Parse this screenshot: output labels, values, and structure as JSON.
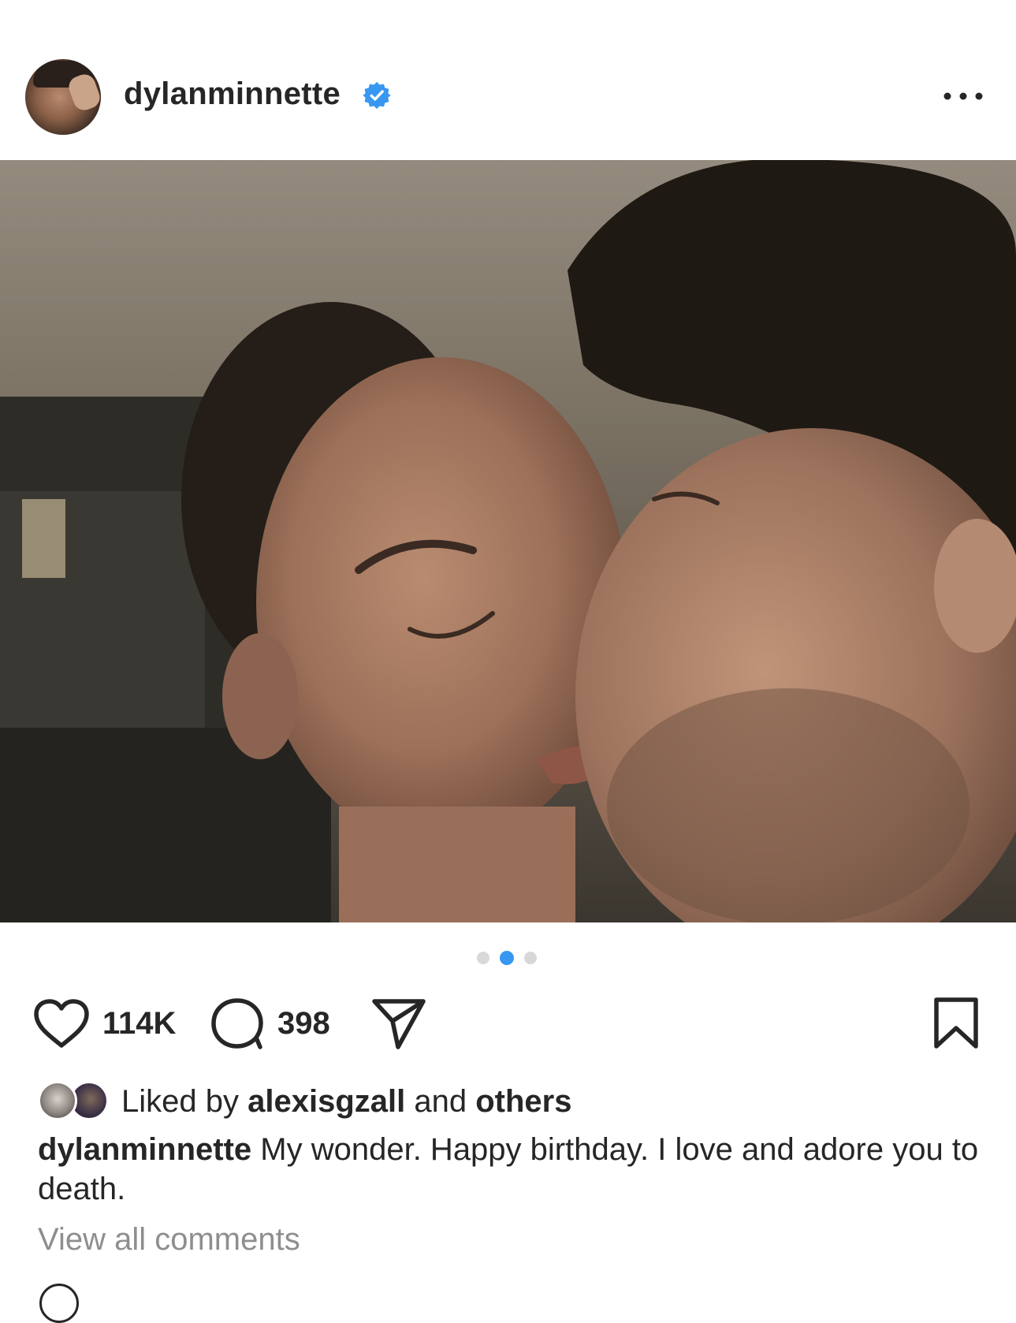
{
  "post": {
    "username": "dylanminnette",
    "verified": true,
    "avatar_icon": "profile-avatar",
    "more_icon": "more-horizontal-icon",
    "media": {
      "description_icon": "photo",
      "carousel": {
        "total": 3,
        "active_index": 1
      }
    },
    "actions": {
      "like_count": "114K",
      "comment_count": "398",
      "like_icon": "heart-icon",
      "comment_icon": "comment-bubble-icon",
      "share_icon": "paper-plane-icon",
      "save_icon": "bookmark-icon"
    },
    "liked_by": {
      "prefix": "Liked by",
      "user": "alexisgzall",
      "joiner": "and",
      "others": "others"
    },
    "caption": {
      "username": "dylanminnette",
      "text": "My wonder. Happy birthday. I love and adore you to death."
    },
    "view_comments": "View all comments"
  },
  "colors": {
    "verified_blue": "#3897f0",
    "text_primary": "#262626",
    "text_secondary": "#8e8e8e",
    "dot_active": "#3897f0",
    "dot_inactive": "#d8d8d8"
  }
}
